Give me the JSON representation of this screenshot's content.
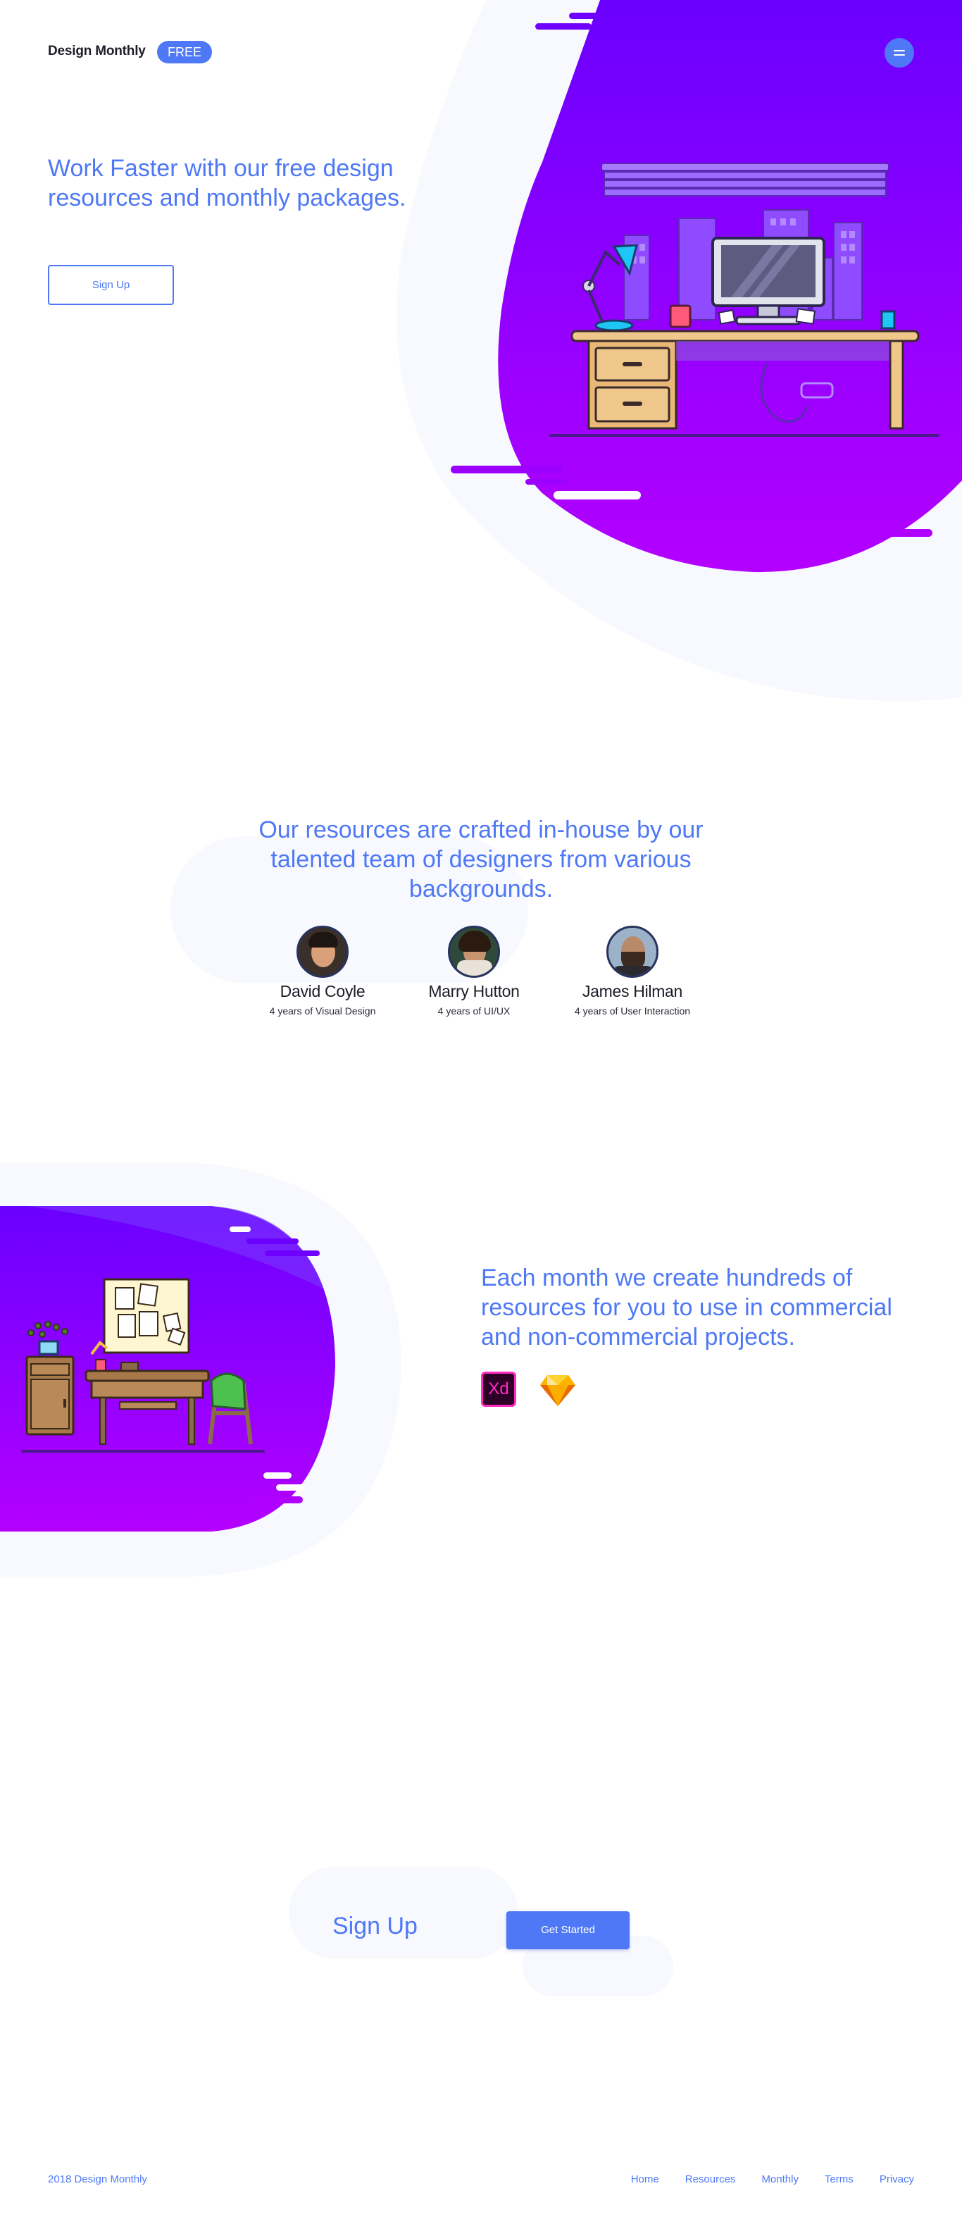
{
  "header": {
    "brand": "Design Monthly",
    "badge": "FREE",
    "menu_icon": "hamburger-icon"
  },
  "hero": {
    "title": "Work Faster with our free design resources and monthly packages.",
    "signup_label": "Sign Up",
    "illustration": "workspace-desk-illustration"
  },
  "team": {
    "title": "Our resources are crafted in-house by our talented team of designers from various backgrounds.",
    "members": [
      {
        "name": "David Coyle",
        "role": "4 years of Visual Design"
      },
      {
        "name": "Marry Hutton",
        "role": "4 years of UI/UX"
      },
      {
        "name": "James Hilman",
        "role": "4 years of User Interaction"
      }
    ]
  },
  "monthly": {
    "title": "Each month we create hundreds of resources for you to use in commercial and non-commercial projects.",
    "tools": [
      {
        "label": "Xd",
        "icon": "adobe-xd-icon"
      },
      {
        "label": "",
        "icon": "sketch-icon"
      }
    ],
    "illustration": "office-corner-illustration"
  },
  "signup": {
    "text": "Sign Up",
    "button_label": "Get Started"
  },
  "footer": {
    "copyright": "2018 Design Monthly",
    "links": [
      "Home",
      "Resources",
      "Monthly",
      "Terms",
      "Privacy"
    ]
  },
  "colors": {
    "accent": "#4e78f5",
    "purple_top": "#6a00ff",
    "purple_bottom": "#b400ff",
    "soft_bg": "#f7f9fe"
  }
}
